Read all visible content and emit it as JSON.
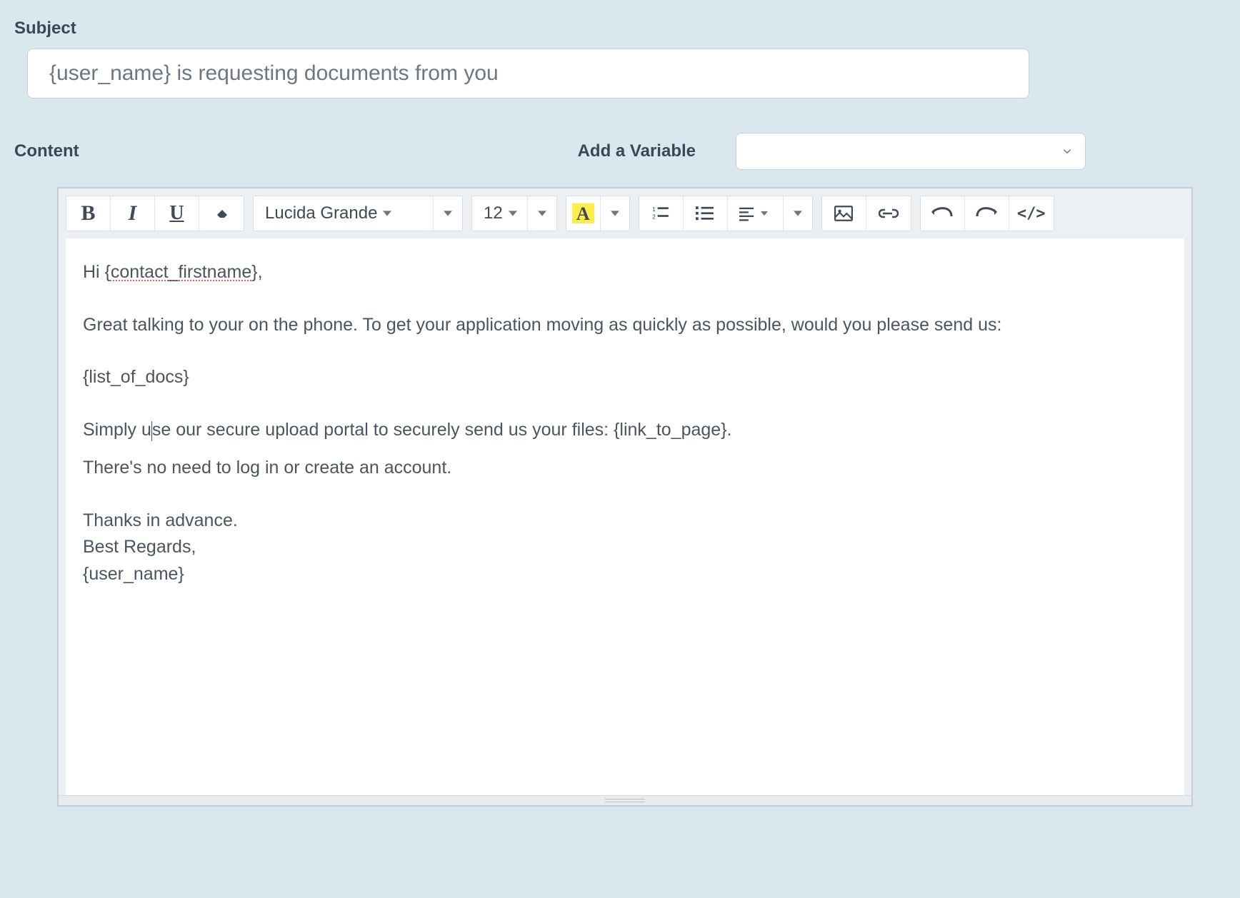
{
  "labels": {
    "subject": "Subject",
    "content": "Content",
    "add_variable": "Add a Variable"
  },
  "subject_value": "{user_name} is requesting documents from you",
  "variable_select": {
    "value": ""
  },
  "toolbar": {
    "font_name": "Lucida Grande",
    "font_size": "12"
  },
  "body": {
    "line1_pre": "Hi {",
    "line1_mark": "contact_firstname",
    "line1_post": "},",
    "line2": "Great talking to your on the phone. To get your application moving as quickly as possible, would you please send us:",
    "line3": "{list_of_docs}",
    "line4_pre": "Simply u",
    "line4_post": "se our secure upload portal to securely send us your files: {link_to_page}.",
    "line5": "There's no need to log in or create an account.",
    "line6": "Thanks in advance.",
    "line7": "Best Regards,",
    "line8": "{user_name}"
  }
}
